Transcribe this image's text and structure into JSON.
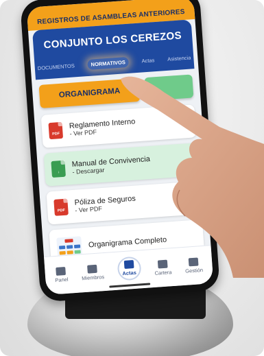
{
  "banner": {
    "text": "REGISTROS DE ASAMBLEAS ANTERIORES"
  },
  "header": {
    "title": "CONJUNTO LOS CEREZOS",
    "tabs": [
      {
        "label": "DOCUMENTOS",
        "active": false
      },
      {
        "label": "NORMATIVOS",
        "active": true
      },
      {
        "label": "Actas",
        "active": false
      },
      {
        "label": "Asistencia",
        "active": false
      }
    ]
  },
  "actions": {
    "organigrama_label": "ORGANIGRAMA"
  },
  "documents": [
    {
      "title": "Reglamento Interno",
      "subtitle": "- Ver PDF",
      "icon": "pdf-icon",
      "icon_text": "PDF"
    },
    {
      "title": "Manual de Convivencia",
      "subtitle": "- Descargar",
      "icon": "download-icon",
      "icon_text": ""
    },
    {
      "title": "Póliza de Seguros",
      "subtitle": "- Ver PDF",
      "icon": "pdf-icon",
      "icon_text": "PDF"
    }
  ],
  "org_card": {
    "title": "Organigrama Completo",
    "icon": "org-chart-icon"
  },
  "bottom_nav": [
    {
      "label": "Panel",
      "icon": "grid-icon",
      "active": false
    },
    {
      "label": "Miembros",
      "icon": "people-icon",
      "active": false
    },
    {
      "label": "Actas",
      "icon": "document-icon",
      "active": true
    },
    {
      "label": "Cartera",
      "icon": "wallet-icon",
      "active": false
    },
    {
      "label": "Gestión",
      "icon": "history-icon",
      "active": false
    }
  ],
  "colors": {
    "banner": "#f3a01a",
    "header": "#1f4aa0",
    "green": "#6fcb8a",
    "pdf_red": "#d83a2c"
  }
}
